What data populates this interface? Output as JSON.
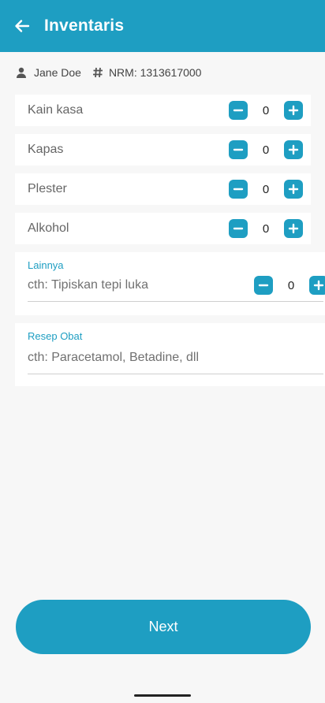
{
  "appbar": {
    "title": "Inventaris",
    "back_icon": "arrow-left-icon"
  },
  "patient": {
    "name": "Jane Doe",
    "nrm": "NRM: 1313617000",
    "person_icon": "person-icon",
    "hash_icon": "hash-icon"
  },
  "items": [
    {
      "label": "Kain kasa",
      "value": "0"
    },
    {
      "label": "Kapas",
      "value": "0"
    },
    {
      "label": "Plester",
      "value": "0"
    },
    {
      "label": "Alkohol",
      "value": "0"
    }
  ],
  "lainnya": {
    "label": "Lainnya",
    "placeholder": "cth: Tipiskan tepi luka",
    "value": "0"
  },
  "resep": {
    "label": "Resep Obat",
    "placeholder": "cth: Paracetamol, Betadine, dll"
  },
  "next_label": "Next",
  "colors": {
    "primary": "#1e9ec2",
    "background": "#f7f7f7"
  }
}
